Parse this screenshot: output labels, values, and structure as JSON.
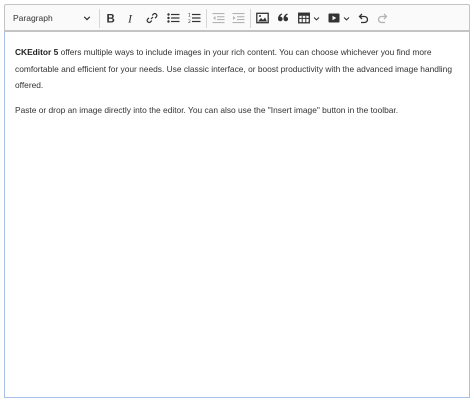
{
  "toolbar": {
    "heading_value": "Paragraph",
    "items": [
      "chevron-down-icon",
      "bold-icon",
      "italic-icon",
      "link-icon",
      "bulleted-list-icon",
      "numbered-list-icon",
      "outdent-icon",
      "indent-icon",
      "image-icon",
      "blockquote-icon",
      "table-icon",
      "media-icon",
      "undo-icon",
      "redo-icon"
    ]
  },
  "content": {
    "paragraph1_bold": "CKEditor 5",
    "paragraph1_rest": " offers multiple ways to include images in your rich content. You can choose whichever you find more comfortable and efficient for your needs. Use classic interface, or boost productivity with the advanced image handling offered.",
    "paragraph2": "Paste or drop an image directly into the editor. You can also use the \"Insert image\" button in the toolbar."
  },
  "colors": {
    "toolbar_bg": "#fafafa",
    "border": "#c4c4c4",
    "focus_border": "#a7c1e6",
    "icon": "#333333",
    "icon_disabled": "#b3b3b3"
  }
}
